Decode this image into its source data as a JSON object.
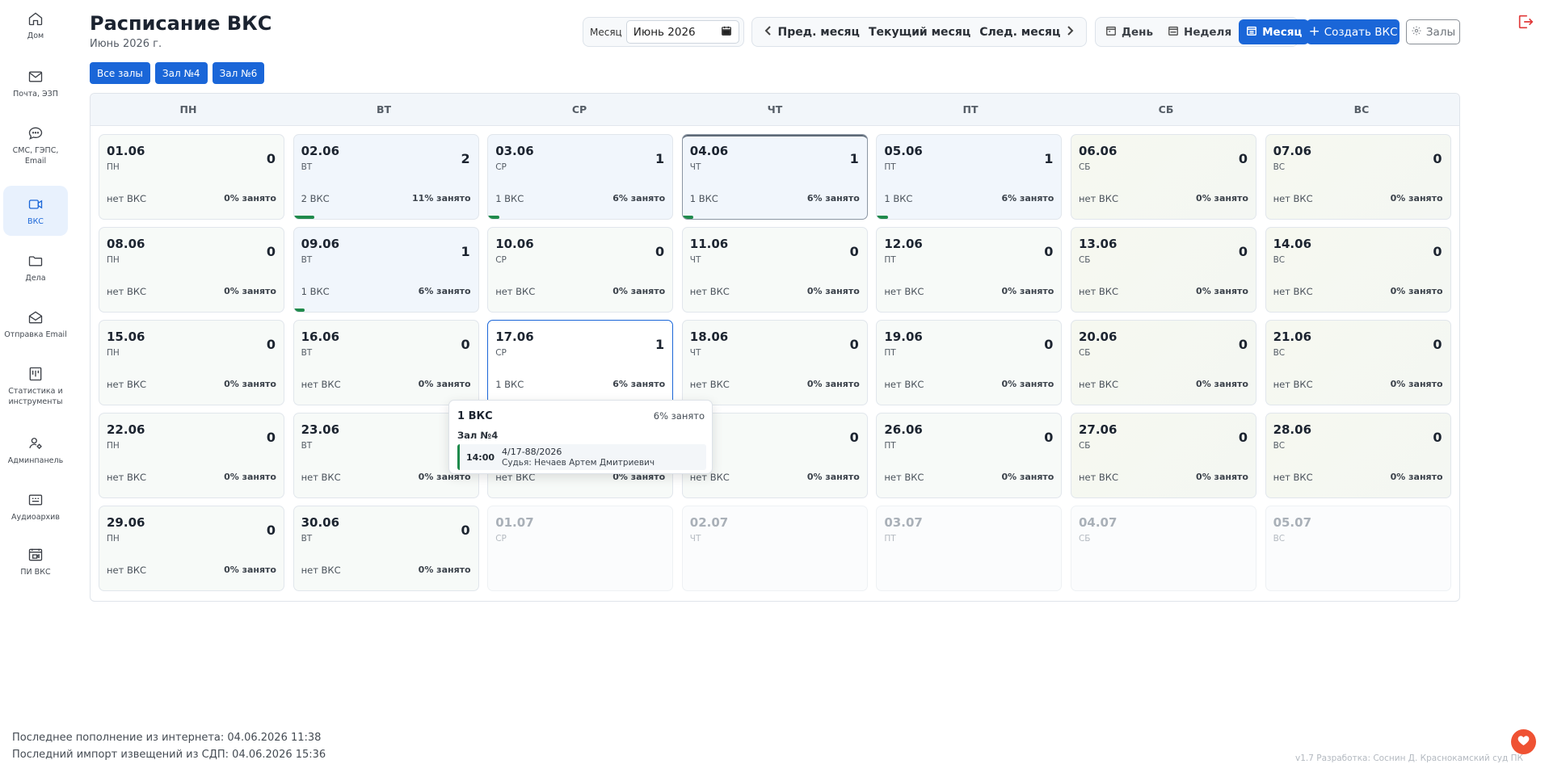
{
  "sidebar": {
    "items": [
      {
        "label": "Дом",
        "icon": "home-icon"
      },
      {
        "label": "Почта, ЭЗП",
        "icon": "mail-icon"
      },
      {
        "label": "СМС, ГЭПС, Email",
        "icon": "chat-icon"
      },
      {
        "label": "ВКС",
        "icon": "video-icon",
        "active": true
      },
      {
        "label": "Дела",
        "icon": "folder-icon"
      },
      {
        "label": "Отправка Email",
        "icon": "email-send-icon"
      },
      {
        "label": "Статистика и инструменты",
        "icon": "stats-icon"
      },
      {
        "label": "Админпанель",
        "icon": "admin-icon"
      },
      {
        "label": "Аудиоархив",
        "icon": "audio-archive-icon"
      },
      {
        "label": "ПИ ВКС",
        "icon": "pi-vks-icon"
      }
    ]
  },
  "header": {
    "title": "Расписание ВКС",
    "subtitle": "Июнь 2026 г.",
    "month_label": "Месяц",
    "month_value": "Июнь 2026",
    "prev_label": "Пред. месяц",
    "current_label": "Текущий месяц",
    "next_label": "След. месяц",
    "view_day": "День",
    "view_week": "Неделя",
    "view_month": "Месяц",
    "create_label": "Создать ВКС",
    "halls_label": "Залы"
  },
  "filters": [
    "Все залы",
    "Зал №4",
    "Зал №6"
  ],
  "calendar": {
    "weekdays": [
      "ПН",
      "ВТ",
      "СР",
      "ЧТ",
      "ПТ",
      "СБ",
      "ВС"
    ],
    "days": [
      {
        "date": "01.06",
        "dow": "ПН",
        "count": "0",
        "vks": "нет ВКС",
        "load": "0% занято",
        "pct": 0
      },
      {
        "date": "02.06",
        "dow": "ВТ",
        "count": "2",
        "vks": "2 ВКС",
        "load": "11% занято",
        "pct": 11
      },
      {
        "date": "03.06",
        "dow": "СР",
        "count": "1",
        "vks": "1 ВКС",
        "load": "6% занято",
        "pct": 6
      },
      {
        "date": "04.06",
        "dow": "ЧТ",
        "count": "1",
        "vks": "1 ВКС",
        "load": "6% занято",
        "pct": 6,
        "today": true
      },
      {
        "date": "05.06",
        "dow": "ПТ",
        "count": "1",
        "vks": "1 ВКС",
        "load": "6% занято",
        "pct": 6
      },
      {
        "date": "06.06",
        "dow": "СБ",
        "count": "0",
        "vks": "нет ВКС",
        "load": "0% занято",
        "pct": 0,
        "weekend": true
      },
      {
        "date": "07.06",
        "dow": "ВС",
        "count": "0",
        "vks": "нет ВКС",
        "load": "0% занято",
        "pct": 0,
        "weekend": true
      },
      {
        "date": "08.06",
        "dow": "ПН",
        "count": "0",
        "vks": "нет ВКС",
        "load": "0% занято",
        "pct": 0
      },
      {
        "date": "09.06",
        "dow": "ВТ",
        "count": "1",
        "vks": "1 ВКС",
        "load": "6% занято",
        "pct": 6
      },
      {
        "date": "10.06",
        "dow": "СР",
        "count": "0",
        "vks": "нет ВКС",
        "load": "0% занято",
        "pct": 0
      },
      {
        "date": "11.06",
        "dow": "ЧТ",
        "count": "0",
        "vks": "нет ВКС",
        "load": "0% занято",
        "pct": 0
      },
      {
        "date": "12.06",
        "dow": "ПТ",
        "count": "0",
        "vks": "нет ВКС",
        "load": "0% занято",
        "pct": 0
      },
      {
        "date": "13.06",
        "dow": "СБ",
        "count": "0",
        "vks": "нет ВКС",
        "load": "0% занято",
        "pct": 0,
        "weekend": true
      },
      {
        "date": "14.06",
        "dow": "ВС",
        "count": "0",
        "vks": "нет ВКС",
        "load": "0% занято",
        "pct": 0,
        "weekend": true
      },
      {
        "date": "15.06",
        "dow": "ПН",
        "count": "0",
        "vks": "нет ВКС",
        "load": "0% занято",
        "pct": 0
      },
      {
        "date": "16.06",
        "dow": "ВТ",
        "count": "0",
        "vks": "нет ВКС",
        "load": "0% занято",
        "pct": 0
      },
      {
        "date": "17.06",
        "dow": "СР",
        "count": "1",
        "vks": "1 ВКС",
        "load": "6% занято",
        "pct": 6,
        "selected": true
      },
      {
        "date": "18.06",
        "dow": "ЧТ",
        "count": "0",
        "vks": "нет ВКС",
        "load": "0% занято",
        "pct": 0
      },
      {
        "date": "19.06",
        "dow": "ПТ",
        "count": "0",
        "vks": "нет ВКС",
        "load": "0% занято",
        "pct": 0
      },
      {
        "date": "20.06",
        "dow": "СБ",
        "count": "0",
        "vks": "нет ВКС",
        "load": "0% занято",
        "pct": 0,
        "weekend": true
      },
      {
        "date": "21.06",
        "dow": "ВС",
        "count": "0",
        "vks": "нет ВКС",
        "load": "0% занято",
        "pct": 0,
        "weekend": true
      },
      {
        "date": "22.06",
        "dow": "ПН",
        "count": "0",
        "vks": "нет ВКС",
        "load": "0% занято",
        "pct": 0
      },
      {
        "date": "23.06",
        "dow": "ВТ",
        "count": "",
        "vks": "нет ВКС",
        "load": "0% занято",
        "pct": 0
      },
      {
        "date": "",
        "dow": "",
        "count": "",
        "vks": "нет ВКС",
        "load": "0% занято",
        "pct": 0
      },
      {
        "date": "",
        "dow": "",
        "count": "0",
        "vks": "нет ВКС",
        "load": "0% занято",
        "pct": 0
      },
      {
        "date": "26.06",
        "dow": "ПТ",
        "count": "0",
        "vks": "нет ВКС",
        "load": "0% занято",
        "pct": 0
      },
      {
        "date": "27.06",
        "dow": "СБ",
        "count": "0",
        "vks": "нет ВКС",
        "load": "0% занято",
        "pct": 0,
        "weekend": true
      },
      {
        "date": "28.06",
        "dow": "ВС",
        "count": "0",
        "vks": "нет ВКС",
        "load": "0% занято",
        "pct": 0,
        "weekend": true
      },
      {
        "date": "29.06",
        "dow": "ПН",
        "count": "0",
        "vks": "нет ВКС",
        "load": "0% занято",
        "pct": 0
      },
      {
        "date": "30.06",
        "dow": "ВТ",
        "count": "0",
        "vks": "нет ВКС",
        "load": "0% занято",
        "pct": 0
      },
      {
        "date": "01.07",
        "dow": "СР",
        "other": true
      },
      {
        "date": "02.07",
        "dow": "ЧТ",
        "other": true
      },
      {
        "date": "03.07",
        "dow": "ПТ",
        "other": true
      },
      {
        "date": "04.07",
        "dow": "СБ",
        "other": true
      },
      {
        "date": "05.07",
        "dow": "ВС",
        "other": true
      }
    ]
  },
  "tooltip": {
    "title": "1 ВКС",
    "load": "6% занято",
    "hall": "Зал №4",
    "time": "14:00",
    "case": "4/17-88/2026",
    "judge": "Судья: Нечаев Артем Дмитриевич"
  },
  "footer": {
    "last_update": "Последнее пополнение из интернета: 04.06.2026 11:38",
    "last_import": "Последний импорт извещений из СДП: 04.06.2026 15:36",
    "version": "v1.7 Разработка: Соснин Д. Краснокамский суд ПК"
  },
  "colors": {
    "accent": "#1a66d8",
    "load_bar": "#1f8a4c",
    "logout": "#e03838",
    "heart": "#ef5233"
  }
}
